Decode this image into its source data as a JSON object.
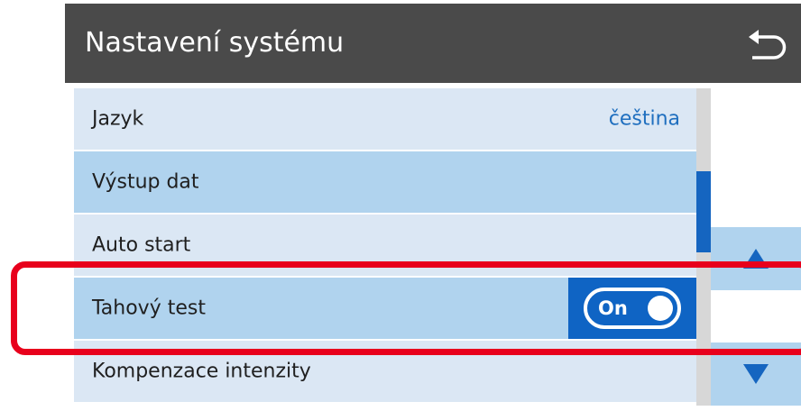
{
  "header": {
    "title": "Nastavení systému",
    "back_icon": "return-arrow-icon"
  },
  "settings": [
    {
      "label": "Jazyk",
      "value": "čeština"
    },
    {
      "label": "Výstup dat"
    },
    {
      "label": "Auto start"
    },
    {
      "label": "Tahový test",
      "toggle": {
        "state": "On",
        "enabled": true
      }
    },
    {
      "label": "Kompenzace intenzity"
    }
  ],
  "navigation": {
    "scroll_up_icon": "triangle-up-icon",
    "scroll_down_icon": "triangle-down-icon"
  },
  "scroll_position": {
    "visible_fraction": 0.26,
    "offset_fraction": 0.26
  },
  "colors": {
    "header_bg": "#4a4a4a",
    "row_light": "#dbe7f4",
    "row_highlight": "#b0d3ee",
    "accent_blue": "#0f64c4",
    "value_text": "#1f6fbf",
    "annotation_red": "#e8001c"
  }
}
